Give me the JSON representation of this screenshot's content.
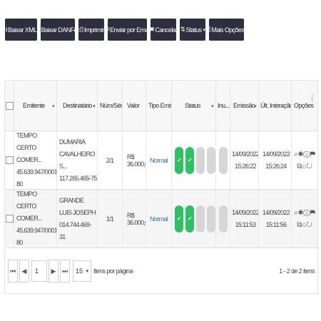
{
  "toolbar": {
    "buttons": [
      {
        "icon": "⭳",
        "label": "Baixar XML"
      },
      {
        "icon": "⭳",
        "label": "Baixar DANFe"
      },
      {
        "icon": "⎙",
        "label": "Imprimir"
      },
      {
        "icon": "✉",
        "label": "Enviar por Email"
      },
      {
        "icon": "✖",
        "label": "Cancelar"
      },
      {
        "icon": "⇅",
        "label": "Status"
      },
      {
        "icon": "☰",
        "label": "Mais Opções"
      }
    ]
  },
  "table": {
    "headers": {
      "emitente": "Emitente",
      "destinatario": "Destinatário",
      "num_serie": "Núm/Série",
      "valor": "Valor",
      "tipo": "Tipo Emiss...",
      "status": "Status",
      "inu": "Inu...",
      "emissao": "Emissão",
      "ult_interacao": "Últ. Interação",
      "opcoes": "Opções"
    },
    "rows": [
      {
        "emitente_l1": "TEMPO CERTO COMER...",
        "emitente_l2": "45.639.947/0001-80",
        "dest_l1": "DUMARIA CAVALHEIRO S...",
        "dest_l2": "117.265.465-75",
        "num_serie": "2/1",
        "valor": "R$ 36.000,00",
        "tipo": "Normal",
        "emissao_date": "14/09/2022",
        "emissao_time": "15:26:22",
        "ult_date": "14/09/2022",
        "ult_time": "15:26:24"
      },
      {
        "emitente_l1": "TEMPO CERTO COMER...",
        "emitente_l2": "45.639.947/0001-80",
        "dest_l1": "GRANDE LUIS JOSEPH",
        "dest_l2": "014.744.469-31",
        "num_serie": "1/1",
        "valor": "R$ 36.000,00",
        "tipo": "Normal",
        "emissao_date": "14/09/2022",
        "emissao_time": "15:11:53",
        "ult_date": "14/09/2022",
        "ult_time": "15:11:56"
      }
    ]
  },
  "pager": {
    "first": "⏮",
    "prev": "◀",
    "page": "1",
    "next": "▶",
    "last": "⏭",
    "per_page": "15",
    "per_page_label": "Itens por página",
    "info": "1 - 2 de 2 itens"
  },
  "colors": {
    "toolbar_bg": "#2e2f3e",
    "status_ok": "#2fbf64",
    "status_off": "#d6d6d6",
    "link": "#3a6fb5"
  }
}
